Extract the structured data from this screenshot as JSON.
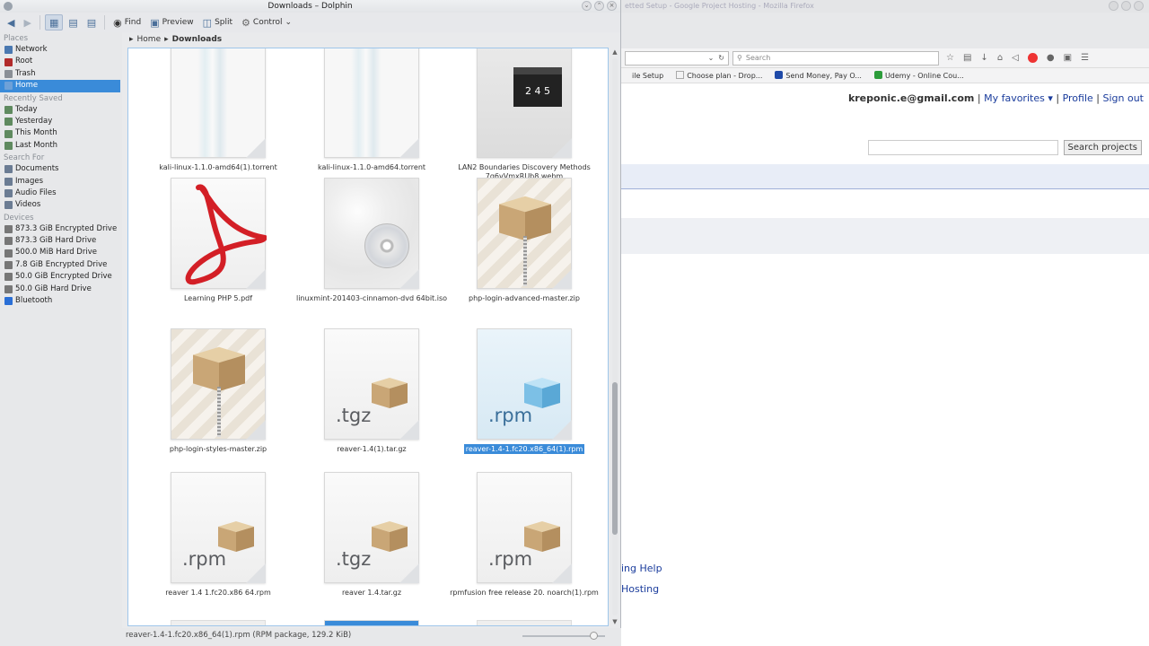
{
  "firefox": {
    "title": "etted Setup - Google Project Hosting - Mozilla Firefox",
    "search_placeholder": "Search",
    "bookmarks": [
      {
        "label": "ile Setup",
        "color": "#999999"
      },
      {
        "label": "Choose plan - Drop...",
        "color": "#aaaaaa"
      },
      {
        "label": "Send Money, Pay O...",
        "color": "#1f4aa8"
      },
      {
        "label": "Udemy - Online Cou...",
        "color": "#2c9c3a"
      }
    ],
    "user_email": "kreponic.e@gmail.com",
    "sep": "|",
    "links": {
      "favorites": "My favorites ▾",
      "profile": "Profile",
      "signout": "Sign out"
    },
    "search_projects_button": "Search projects",
    "page_links": [
      "ing Help",
      "Hosting"
    ]
  },
  "dolphin": {
    "title": "Downloads – Dolphin",
    "toolbar": {
      "find": "Find",
      "preview": "Preview",
      "split": "Split",
      "control": "Control"
    },
    "places_header": "Places",
    "places": [
      {
        "label": "Network",
        "color": "#4a78b0"
      },
      {
        "label": "Root",
        "color": "#b12b2b"
      },
      {
        "label": "Trash",
        "color": "#8a8f96"
      },
      {
        "label": "Home",
        "color": "#6ea1d8",
        "selected": true
      }
    ],
    "recent_header": "Recently Saved",
    "recent": [
      {
        "label": "Today",
        "color": "#5f8a5f"
      },
      {
        "label": "Yesterday",
        "color": "#5f8a5f"
      },
      {
        "label": "This Month",
        "color": "#5f8a5f"
      },
      {
        "label": "Last Month",
        "color": "#5f8a5f"
      }
    ],
    "search_header": "Search For",
    "search": [
      {
        "label": "Documents",
        "color": "#6b7c93"
      },
      {
        "label": "Images",
        "color": "#6b7c93"
      },
      {
        "label": "Audio Files",
        "color": "#6b7c93"
      },
      {
        "label": "Videos",
        "color": "#6b7c93"
      }
    ],
    "devices_header": "Devices",
    "devices": [
      {
        "label": "873.3 GiB Encrypted Drive",
        "color": "#777777"
      },
      {
        "label": "873.3 GiB Hard Drive",
        "color": "#777777"
      },
      {
        "label": "500.0 MiB Hard Drive",
        "color": "#777777"
      },
      {
        "label": "7.8 GiB Encrypted Drive",
        "color": "#777777"
      },
      {
        "label": "50.0 GiB Encrypted Drive",
        "color": "#777777"
      },
      {
        "label": "50.0 GiB Hard Drive",
        "color": "#777777"
      },
      {
        "label": "Bluetooth",
        "color": "#2a6fd6"
      }
    ],
    "breadcrumb": {
      "home": "Home",
      "current": "Downloads"
    },
    "files": [
      {
        "name": "kali-linux-1.1.0-amd64(1).torrent",
        "kind": "torrent"
      },
      {
        "name": "kali-linux-1.1.0-amd64.torrent",
        "kind": "torrent"
      },
      {
        "name": "LAN2 Boundaries  Discovery Methods 7g6vVmxRUb8.webm",
        "kind": "video",
        "clap": "2 4 5"
      },
      {
        "name": "Learning PHP 5.pdf",
        "kind": "pdf"
      },
      {
        "name": "linuxmint-201403-cinnamon-dvd 64bit.iso",
        "kind": "iso"
      },
      {
        "name": "php-login-advanced-master.zip",
        "kind": "zip"
      },
      {
        "name": "php-login-styles-master.zip",
        "kind": "zip"
      },
      {
        "name": "reaver-1.4(1).tar.gz",
        "kind": "tgz",
        "ext": ".tgz"
      },
      {
        "name": "reaver-1.4-1.fc20.x86_64(1).rpm",
        "kind": "rpm-sel",
        "ext": ".rpm",
        "selected": true
      },
      {
        "name": "reaver 1.4 1.fc20.x86 64.rpm",
        "kind": "rpm",
        "ext": ".rpm"
      },
      {
        "name": "reaver 1.4.tar.gz",
        "kind": "tgz",
        "ext": ".tgz"
      },
      {
        "name": "rpmfusion free release 20. noarch(1).rpm",
        "kind": "rpm",
        "ext": ".rpm"
      }
    ],
    "status": "reaver-1.4-1.fc20.x86_64(1).rpm (RPM package, 129.2 KiB)",
    "zoom_level": 0.86
  }
}
